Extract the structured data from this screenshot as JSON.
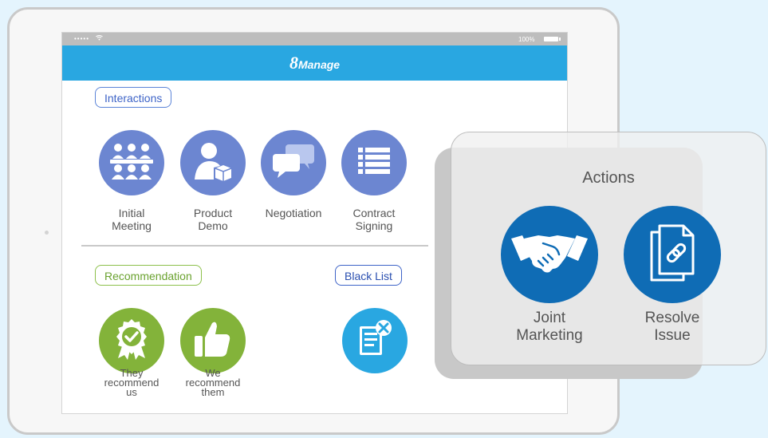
{
  "statusbar": {
    "signal": "•••••",
    "battery_pct": "100%"
  },
  "appbar": {
    "brand_number": "8",
    "brand_word": "Manage"
  },
  "interactions": {
    "header": "Interactions",
    "items": [
      {
        "line1": "Initial",
        "line2": "Meeting",
        "icon": "meeting-icon"
      },
      {
        "line1": "Product",
        "line2": "Demo",
        "icon": "product-demo-icon"
      },
      {
        "line1": "Negotiation",
        "line2": "",
        "icon": "chat-bubbles-icon"
      },
      {
        "line1": "Contract",
        "line2": "Signing",
        "icon": "list-icon"
      }
    ]
  },
  "recommendation": {
    "header": "Recommendation",
    "items": [
      {
        "line1": "They",
        "line2": "recommend",
        "line3": "us",
        "icon": "award-ribbon-icon"
      },
      {
        "line1": "We",
        "line2": "recommend",
        "line3": "them",
        "icon": "thumbs-up-icon"
      }
    ]
  },
  "blacklist": {
    "header": "Black List",
    "icon": "document-x-icon"
  },
  "actions": {
    "title": "Actions",
    "items": [
      {
        "line1": "Joint",
        "line2": "Marketing",
        "icon": "handshake-icon"
      },
      {
        "line1": "Resolve",
        "line2": "Issue",
        "icon": "linked-documents-icon"
      }
    ]
  },
  "colors": {
    "appbar": "#29a7e1",
    "interaction_circle": "#6c86d1",
    "recommendation_circle": "#83b33a",
    "blacklist_circle": "#29a7e1",
    "action_circle": "#0f6cb5",
    "background": "#e4f4fd"
  }
}
